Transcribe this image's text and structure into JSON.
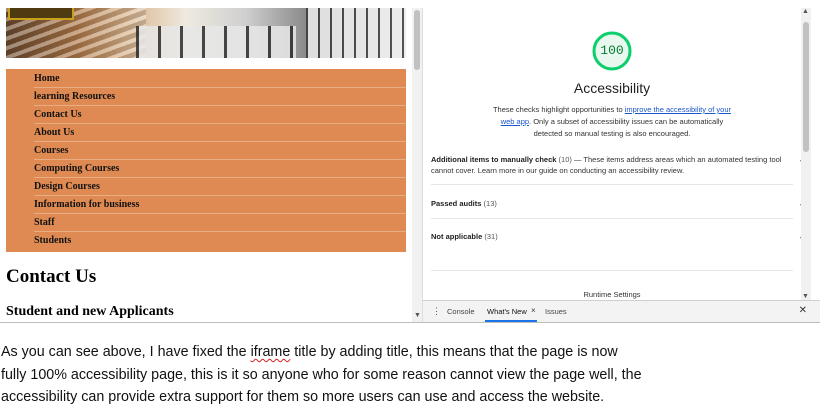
{
  "site": {
    "nav_items": [
      "Home",
      "learning Resources",
      "Contact Us",
      "About Us",
      "Courses",
      "Computing Courses",
      "Design Courses",
      "Information for business",
      "Staff",
      "Students"
    ],
    "heading": "Contact Us",
    "subheading": "Student and new Applicants",
    "nav_color": "#de8a52"
  },
  "lighthouse": {
    "score": "100",
    "score_fraction": 1.0,
    "score_color": "#0cce6b",
    "category_title": "Accessibility",
    "desc_before": "These checks highlight opportunities to ",
    "desc_link": "improve the accessibility of your web app",
    "desc_after": ". Only a subset of accessibility issues can be automatically detected so manual testing is also encouraged.",
    "manual": {
      "title": "Additional items to manually check",
      "count": "(10)",
      "desc_before": " — These items address areas which an automated testing tool cannot cover. Learn more in our guide on ",
      "desc_link": "conducting an accessibility review",
      "desc_after": "."
    },
    "passed": {
      "title": "Passed audits",
      "count": "(13)"
    },
    "not_applicable": {
      "title": "Not applicable",
      "count": "(31)"
    },
    "runtime_settings": "Runtime Settings"
  },
  "drawer": {
    "tabs": [
      "Console",
      "What's New",
      "Issues"
    ],
    "active_tab": "What's New",
    "tab_close": "×",
    "close": "✕"
  },
  "icons": {
    "chevron": "⌄",
    "kebab": "⋮",
    "scroll_up": "▲",
    "scroll_down": "▼"
  },
  "document": {
    "line1_before": "As you can see above, I have fixed the ",
    "line1_misspelled": "iframe",
    "line1_after": " title by adding title, this means that the page is now",
    "line2": "fully 100% accessibility page, this is it so anyone who for some reason cannot view the page well, the",
    "line3": "accessibility can provide extra support for them so more users can use and access the website."
  }
}
